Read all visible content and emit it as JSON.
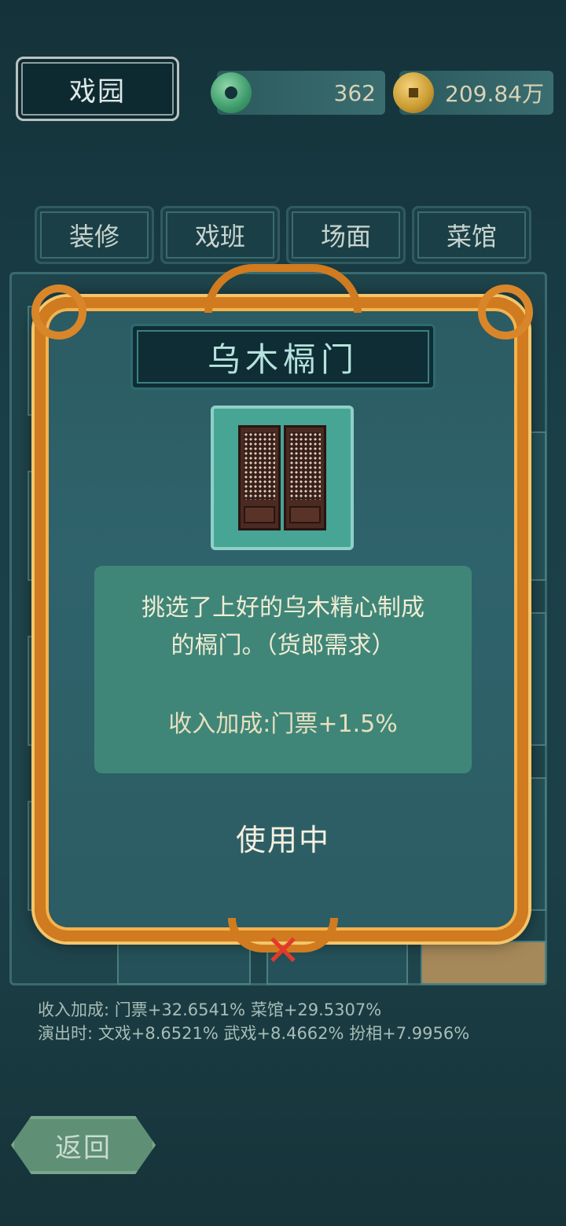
{
  "header": {
    "title": "戏园",
    "currencies": [
      {
        "icon": "jade-coin-icon",
        "value": "362"
      },
      {
        "icon": "gold-coin-icon",
        "value": "209.84万"
      }
    ]
  },
  "tabs": [
    {
      "label": "装修"
    },
    {
      "label": "戏班"
    },
    {
      "label": "场面"
    },
    {
      "label": "菜馆"
    }
  ],
  "modal": {
    "item_name": "乌木槅门",
    "item_icon": "lattice-door-icon",
    "description_line1": "挑选了上好的乌木精心制成",
    "description_line2": "的槅门。（货郎需求）",
    "bonus": "收入加成:门票+1.5%",
    "status": "使用中",
    "close_icon": "close-icon"
  },
  "stats": {
    "line1": "收入加成: 门票+32.6541% 菜馆+29.5307%",
    "line2": "演出时: 文戏+8.6521% 武戏+8.4662% 扮相+7.9956%"
  },
  "back_button": {
    "label": "返回"
  },
  "colors": {
    "frame": "#d07b1f",
    "close": "#e23a2a",
    "description_bg": "#3f8678"
  }
}
